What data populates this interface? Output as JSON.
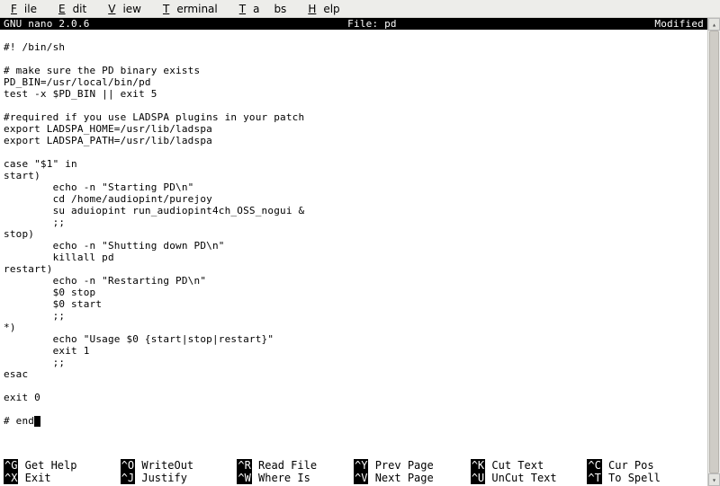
{
  "menu": {
    "file": "File",
    "edit": "Edit",
    "view": "View",
    "terminal": "Terminal",
    "tabs": "Tabs",
    "help": "Help"
  },
  "titlebar": {
    "left": "  GNU nano 2.0.6",
    "center": "File: pd",
    "right": "Modified  "
  },
  "content": [
    "",
    "#! /bin/sh",
    "",
    "# make sure the PD binary exists",
    "PD_BIN=/usr/local/bin/pd",
    "test -x $PD_BIN || exit 5",
    "",
    "#required if you use LADSPA plugins in your patch",
    "export LADSPA_HOME=/usr/lib/ladspa",
    "export LADSPA_PATH=/usr/lib/ladspa",
    "",
    "case \"$1\" in",
    "start)",
    "        echo -n \"Starting PD\\n\"",
    "        cd /home/audiopint/purejoy",
    "        su aduiopint run_audiopint4ch_OSS_nogui &",
    "        ;;",
    "stop)",
    "        echo -n \"Shutting down PD\\n\"",
    "        killall pd",
    "restart)",
    "        echo -n \"Restarting PD\\n\"",
    "        $0 stop",
    "        $0 start",
    "        ;;",
    "*)",
    "        echo \"Usage $0 {start|stop|restart}\"",
    "        exit 1",
    "        ;;",
    "esac",
    "",
    "exit 0",
    "",
    "# end"
  ],
  "shortcuts": {
    "row1": [
      {
        "key": "^G",
        "label": "Get Help"
      },
      {
        "key": "^O",
        "label": "WriteOut"
      },
      {
        "key": "^R",
        "label": "Read File"
      },
      {
        "key": "^Y",
        "label": "Prev Page"
      },
      {
        "key": "^K",
        "label": "Cut Text"
      },
      {
        "key": "^C",
        "label": "Cur Pos"
      }
    ],
    "row2": [
      {
        "key": "^X",
        "label": "Exit"
      },
      {
        "key": "^J",
        "label": "Justify"
      },
      {
        "key": "^W",
        "label": "Where Is"
      },
      {
        "key": "^V",
        "label": "Next Page"
      },
      {
        "key": "^U",
        "label": "UnCut Text"
      },
      {
        "key": "^T",
        "label": "To Spell"
      }
    ]
  }
}
